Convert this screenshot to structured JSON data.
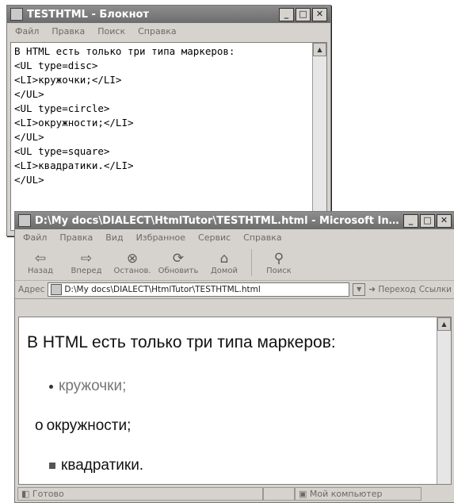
{
  "notepad": {
    "title": "TESTHTML - Блокнот",
    "menu": [
      "Файл",
      "Правка",
      "Поиск",
      "Справка"
    ],
    "lines": [
      "В HTML есть только три типа маркеров:",
      "<UL type=disc>",
      "<LI>кружочки;</LI>",
      "</UL>",
      "<UL type=circle>",
      "<LI>окружности;</LI>",
      "</UL>",
      "<UL type=square>",
      "<LI>квадратики.</LI>",
      "</UL>"
    ]
  },
  "browser": {
    "title": "D:\\My docs\\DIALECT\\HtmlTutor\\TESTHTML.html - Microsoft Inter...",
    "menu": [
      "Файл",
      "Правка",
      "Вид",
      "Избранное",
      "Сервис",
      "Справка"
    ],
    "toolbar": {
      "back": "Назад",
      "forward": "Вперед",
      "stop": "Останов.",
      "refresh": "Обновить",
      "home": "Домой",
      "search": "Поиск"
    },
    "address": {
      "label": "Адрес",
      "value": "D:\\My docs\\DIALECT\\HtmlTutor\\TESTHTML.html",
      "go": "Переход",
      "links": "Ссылки"
    },
    "page": {
      "heading": "В HTML есть только три типа маркеров:",
      "items": [
        {
          "marker": "disc",
          "text": "кружочки;"
        },
        {
          "marker": "circle",
          "text": "окружности;"
        },
        {
          "marker": "square",
          "text": "квадратики."
        }
      ]
    },
    "status": {
      "ready": "Готово",
      "zone": "Мой компьютер"
    }
  }
}
